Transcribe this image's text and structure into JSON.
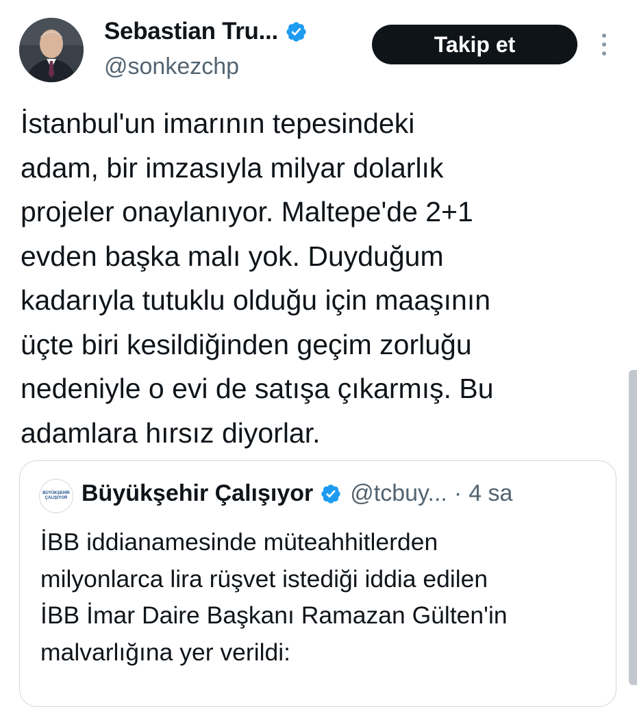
{
  "author": {
    "name": "Sebastian Tru...",
    "handle": "@sonkezchp",
    "verified_color": "#1d9bf0"
  },
  "follow_button": {
    "label": "Takip et"
  },
  "more_menu": {
    "icon": "more-vertical-icon"
  },
  "tweet": {
    "lines": [
      "İstanbul'un imarının tepesindeki",
      "adam, bir imzasıyla milyar dolarlık",
      "projeler onaylanıyor. Maltepe'de 2+1",
      "evden başka malı yok. Duyduğum",
      "kadarıyla tutuklu olduğu için maaşının",
      "üçte biri kesildiğinden geçim zorluğu",
      "nedeniyle o evi de satışa çıkarmış. Bu",
      "adamlara hırsız diyorlar."
    ]
  },
  "quote": {
    "name": "Büyükşehir Çalışıyor",
    "handle": "@tcbuy...",
    "separator": "·",
    "time": "4 sa",
    "avatar_text": [
      "BÜYÜKŞEHİR",
      "ÇALIŞIYOR"
    ],
    "lines": [
      "İBB iddianamesinde müteahhitlerden",
      "milyonlarca lira rüşvet istediği iddia edilen",
      "İBB İmar Daire Başkanı Ramazan Gülten'in",
      "malvarlığına yer verildi:"
    ]
  }
}
